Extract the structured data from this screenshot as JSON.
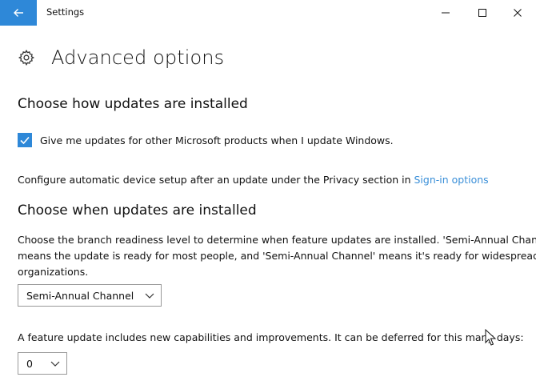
{
  "window": {
    "app_title": "Settings"
  },
  "header": {
    "title": "Advanced options",
    "icon": "gear-icon"
  },
  "section_install": {
    "title": "Choose how updates are installed",
    "checkbox_label": "Give me updates for other Microsoft products when I update Windows.",
    "checkbox_checked": true,
    "config_text": "Configure automatic device setup after an update under the Privacy section in ",
    "config_link": "Sign-in options"
  },
  "section_when": {
    "title": "Choose when updates are installed",
    "branch_desc_lines": [
      "Choose the branch readiness level to determine when feature updates are installed. 'Semi-Annual Channel (Targeted)'",
      "means the update is ready for most people, and 'Semi-Annual Channel' means it's ready for widespread use in",
      "organizations."
    ],
    "branch_selected": "Semi-Annual Channel",
    "deferral_text": "A feature update includes new capabilities and improvements. It can be deferred for this many days:",
    "deferral_selected": "0"
  },
  "colors": {
    "accent": "#2e88d8",
    "link": "#3a8fd8"
  }
}
